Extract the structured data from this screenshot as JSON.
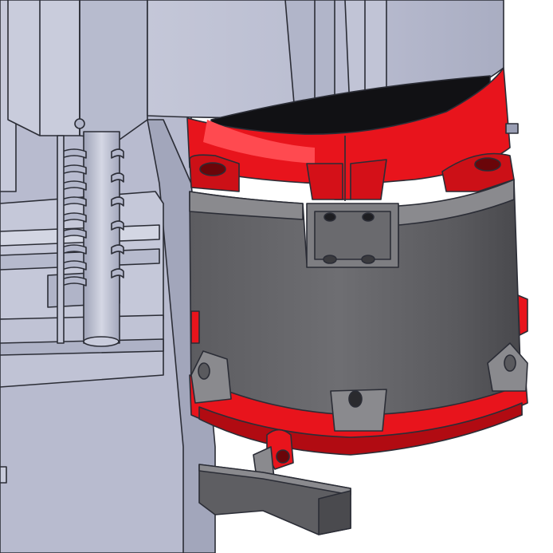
{
  "scene": {
    "kind": "cad-render",
    "background": "#ffffff",
    "palette": {
      "frame_light": "#c9ccdc",
      "frame_mid": "#b4b8cc",
      "frame_dark": "#9a9eb4",
      "frame_edge": "#2b2d36",
      "housing_dark": "#5a5a5e",
      "housing_mid": "#6c6c70",
      "housing_light": "#8a8a8e",
      "red_primary": "#e8141c",
      "red_dark": "#b10b12",
      "red_light": "#ff4a50",
      "shadow_black": "#111114"
    },
    "icons": [
      "cad-model-icon"
    ]
  }
}
